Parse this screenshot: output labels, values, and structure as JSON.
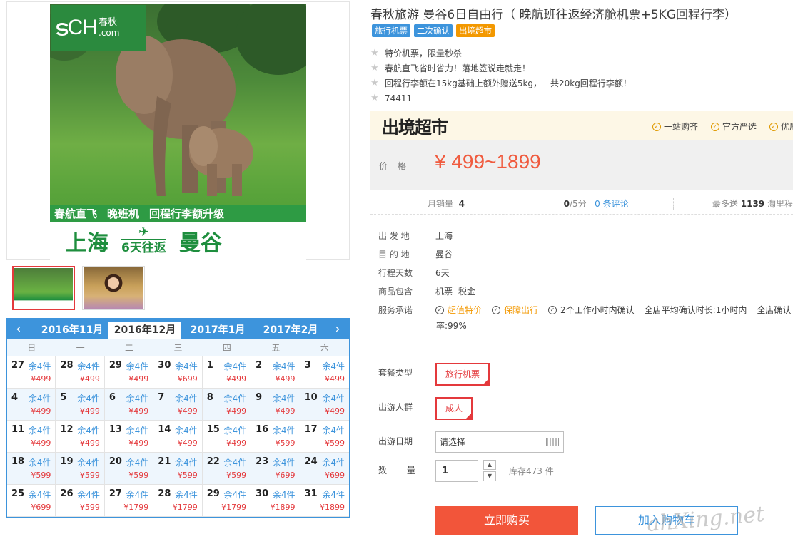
{
  "gallery": {
    "logo": {
      "brand": "CH",
      "domain": ".com",
      "cn": "春秋"
    },
    "banner_line1": [
      "春航直飞",
      "晚班机",
      "回程行李额升级"
    ],
    "banner_from": "上海",
    "banner_days": "6天往返",
    "banner_to": "曼谷"
  },
  "calendar": {
    "months": [
      "2016年11月",
      "2016年12月",
      "2017年1月",
      "2017年2月"
    ],
    "active_month": 1,
    "weekdays": [
      "日",
      "一",
      "二",
      "三",
      "四",
      "五",
      "六"
    ],
    "remain_label": "余4件",
    "days": [
      {
        "d": "27",
        "p": "¥499"
      },
      {
        "d": "28",
        "p": "¥499"
      },
      {
        "d": "29",
        "p": "¥499"
      },
      {
        "d": "30",
        "p": "¥699"
      },
      {
        "d": "1",
        "p": "¥499"
      },
      {
        "d": "2",
        "p": "¥499"
      },
      {
        "d": "3",
        "p": "¥499"
      },
      {
        "d": "4",
        "p": "¥499"
      },
      {
        "d": "5",
        "p": "¥499"
      },
      {
        "d": "6",
        "p": "¥499"
      },
      {
        "d": "7",
        "p": "¥499"
      },
      {
        "d": "8",
        "p": "¥499"
      },
      {
        "d": "9",
        "p": "¥499"
      },
      {
        "d": "10",
        "p": "¥499"
      },
      {
        "d": "11",
        "p": "¥499"
      },
      {
        "d": "12",
        "p": "¥499"
      },
      {
        "d": "13",
        "p": "¥499"
      },
      {
        "d": "14",
        "p": "¥499"
      },
      {
        "d": "15",
        "p": "¥499"
      },
      {
        "d": "16",
        "p": "¥599"
      },
      {
        "d": "17",
        "p": "¥599"
      },
      {
        "d": "18",
        "p": "¥599"
      },
      {
        "d": "19",
        "p": "¥599"
      },
      {
        "d": "20",
        "p": "¥599"
      },
      {
        "d": "21",
        "p": "¥599"
      },
      {
        "d": "22",
        "p": "¥599"
      },
      {
        "d": "23",
        "p": "¥699"
      },
      {
        "d": "24",
        "p": "¥699"
      },
      {
        "d": "25",
        "p": "¥699"
      },
      {
        "d": "26",
        "p": "¥599"
      },
      {
        "d": "27",
        "p": "¥1799"
      },
      {
        "d": "28",
        "p": "¥1799"
      },
      {
        "d": "29",
        "p": "¥1799"
      },
      {
        "d": "30",
        "p": "¥1899"
      },
      {
        "d": "31",
        "p": "¥1899"
      }
    ]
  },
  "product": {
    "title": "春秋旅游 曼谷6日自由行（ 晚航班往返经济舱机票+5KG回程行李）",
    "tags": [
      {
        "label": "旅行机票",
        "color": "#3d94dc"
      },
      {
        "label": "二次确认",
        "color": "#3d94dc"
      },
      {
        "label": "出境超市",
        "color": "#f39800"
      }
    ],
    "features": [
      "特价机票，限量秒杀",
      "春航直飞省时省力！落地签说走就走！",
      "回程行李额在15kg基础上额外赠送5kg，一共20kg回程行李额！",
      "74411"
    ]
  },
  "market": {
    "logo": "出境超市",
    "tags": [
      "一站购齐",
      "官方严选",
      "优质"
    ],
    "price_label": "价格",
    "price": "¥ 499~1899"
  },
  "stats": {
    "monthly_label": "月销量",
    "monthly_value": "4",
    "score": "0",
    "score_suffix": "/5分",
    "reviews": "0 条评论",
    "points_prefix": "最多送",
    "points_value": "1139",
    "points_suffix": "淘里程"
  },
  "info": [
    {
      "k": "出 发 地",
      "v": [
        "上海"
      ]
    },
    {
      "k": "目 的 地",
      "v": [
        "曼谷"
      ]
    },
    {
      "k": "行程天数",
      "v": [
        "6天"
      ]
    },
    {
      "k": "商品包含",
      "v": [
        "机票",
        "税金"
      ]
    }
  ],
  "service": {
    "label": "服务承诺",
    "items": [
      {
        "label": "超值特价",
        "orange": true
      },
      {
        "label": "保障出行",
        "orange": true
      },
      {
        "label": "2个工作小时内确认",
        "orange": false
      }
    ],
    "extra1": "全店平均确认时长:1小时内",
    "extra2": "全店确认",
    "wrap": "率:99%"
  },
  "options": {
    "package_label": "套餐类型",
    "package_value": "旅行机票",
    "crowd_label": "出游人群",
    "crowd_value": "成人",
    "date_label": "出游日期",
    "date_placeholder": "请选择",
    "qty_label": "数　量",
    "qty_value": "1",
    "stock": "库存473 件"
  },
  "actions": {
    "buy": "立即购买",
    "cart": "加入购物车"
  },
  "watermark": "ahXing.net"
}
